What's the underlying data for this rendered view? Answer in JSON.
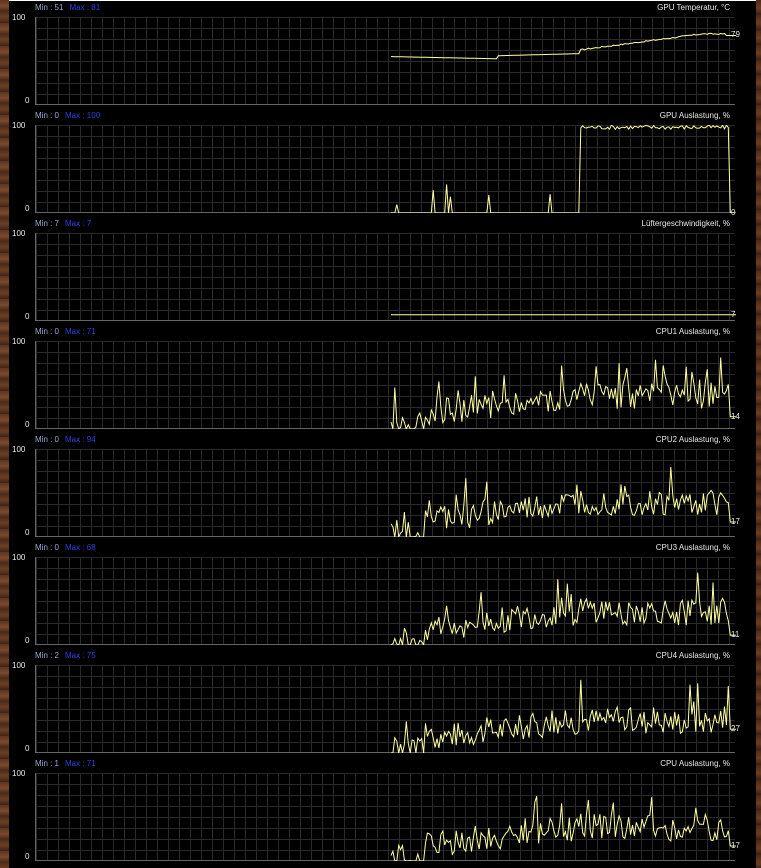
{
  "window": {
    "frame": "wood-texture",
    "background": "#000000"
  },
  "colors": {
    "line": "#ffffa0",
    "grid": "#2a2a2a",
    "min_text": "#9aa6d8",
    "max_text": "#2f3fe0",
    "text": "#e8e8e8"
  },
  "panels": [
    {
      "title": "GPU Temperatur, °C",
      "min_label": "Min : 51",
      "max_label": "Max : 81",
      "y_max": "100",
      "y_min": "0",
      "current": "79",
      "series_type": "temp"
    },
    {
      "title": "GPU Auslastung, %",
      "min_label": "Min : 0",
      "max_label": "Max : 100",
      "y_max": "100",
      "y_min": "0",
      "current": "0",
      "series_type": "gpuload"
    },
    {
      "title": "Lüftergeschwindigkeit, %",
      "min_label": "Min : 7",
      "max_label": "Max : 7",
      "y_max": "100",
      "y_min": "0",
      "current": "7",
      "series_type": "fan"
    },
    {
      "title": "CPU1 Auslastung, %",
      "min_label": "Min : 0",
      "max_label": "Max : 71",
      "y_max": "100",
      "y_min": "0",
      "current": "14",
      "series_type": "cpu"
    },
    {
      "title": "CPU2 Auslastung, %",
      "min_label": "Min : 0",
      "max_label": "Max : 94",
      "y_max": "100",
      "y_min": "0",
      "current": "17",
      "series_type": "cpu"
    },
    {
      "title": "CPU3 Auslastung, %",
      "min_label": "Min : 0",
      "max_label": "Max : 68",
      "y_max": "100",
      "y_min": "0",
      "current": "11",
      "series_type": "cpu"
    },
    {
      "title": "CPU4 Auslastung, %",
      "min_label": "Min : 2",
      "max_label": "Max : 75",
      "y_max": "100",
      "y_min": "0",
      "current": "27",
      "series_type": "cpu"
    },
    {
      "title": "CPU Auslastung, %",
      "min_label": "Min : 1",
      "max_label": "Max : 71",
      "y_max": "100",
      "y_min": "0",
      "current": "17",
      "series_type": "cpu"
    }
  ]
}
